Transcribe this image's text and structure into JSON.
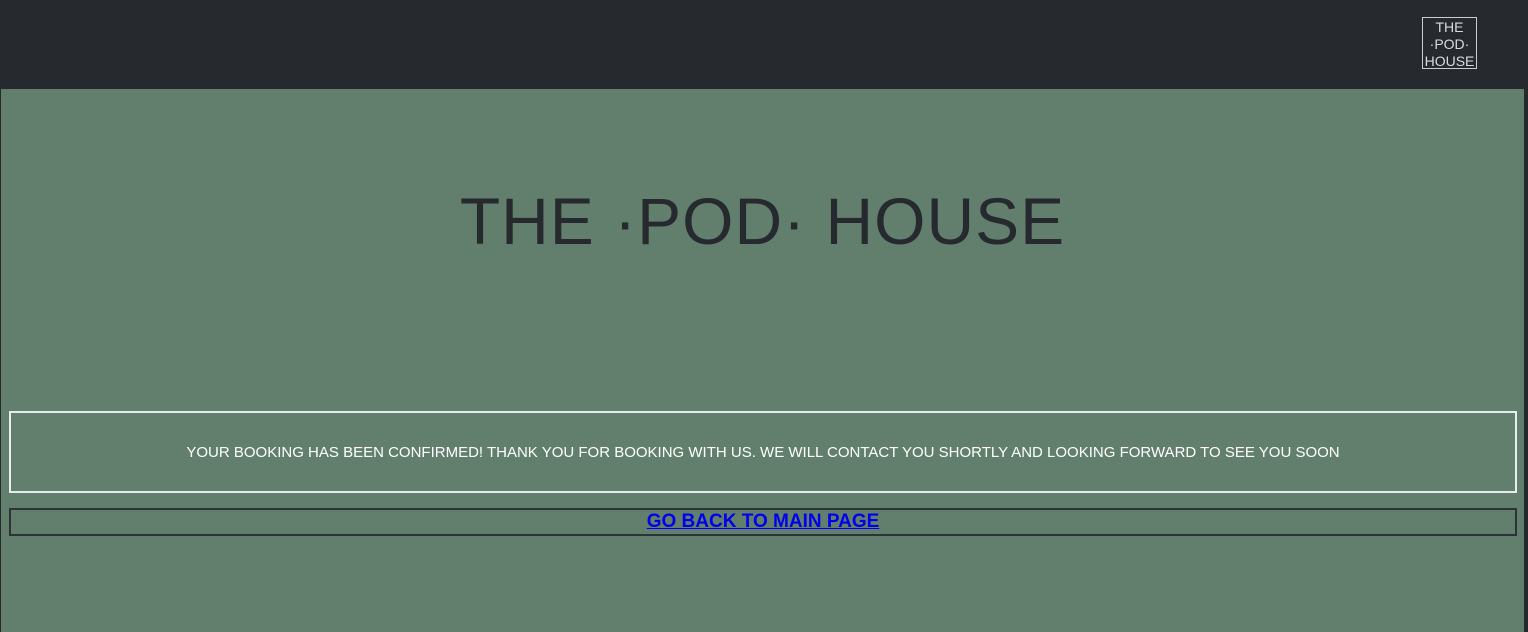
{
  "header": {
    "logo_lines": [
      "THE",
      "·POD·",
      "HOUSE"
    ]
  },
  "hero": {
    "title": "THE ·POD· HOUSE"
  },
  "confirmation": {
    "message": "YOUR BOOKING HAS BEEN CONFIRMED! THANK YOU FOR BOOKING WITH US. WE WILL CONTACT YOU SHORTLY AND LOOKING FORWARD TO SEE YOU SOON"
  },
  "navigation": {
    "back_link_label": "GO BACK TO MAIN PAGE"
  },
  "colors": {
    "header_bg": "#262a2f",
    "main_bg": "#617f6c",
    "title_text": "#262a2f",
    "link": "#0000ee"
  }
}
